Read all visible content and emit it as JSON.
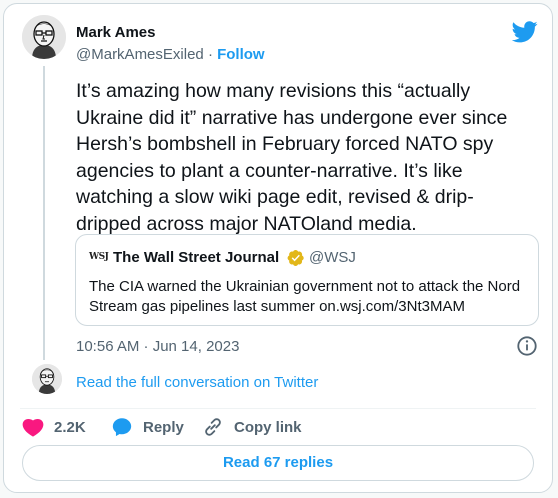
{
  "author": {
    "name": "Mark Ames",
    "handle": "@MarkAmesExiled",
    "separator": "·",
    "follow_label": "Follow",
    "avatar_icon": "avatar-portrait-icon"
  },
  "tweet": {
    "text": "It’s amazing how many revisions this “actually Ukraine did it” narrative has undergone ever since Hersh’s bombshell in February forced NATO spy agencies to plant a counter-narrative. It’s like watching a slow wiki page edit, revised & drip-dripped across major NATOland media.",
    "timestamp": "10:56 AM · Jun 14, 2023"
  },
  "quote": {
    "logo_text": "WSJ",
    "name": "The Wall Street Journal",
    "handle": "@WSJ",
    "verified_badge": "gold-verified-badge-icon",
    "text": "The CIA warned the Ukrainian government not to attack the Nord Stream gas pipelines last summer on.wsj.com/3Nt3MAM"
  },
  "links": {
    "read_conversation": "Read the full conversation on Twitter",
    "read_replies": "Read 67 replies"
  },
  "actions": {
    "likes": "2.2K",
    "reply_label": "Reply",
    "copy_link_label": "Copy link"
  },
  "colors": {
    "accent": "#1d9bf0",
    "like_red": "#f91880",
    "verified_gold": "#e2b719",
    "muted_text": "#536471",
    "border": "#cfd9de"
  }
}
